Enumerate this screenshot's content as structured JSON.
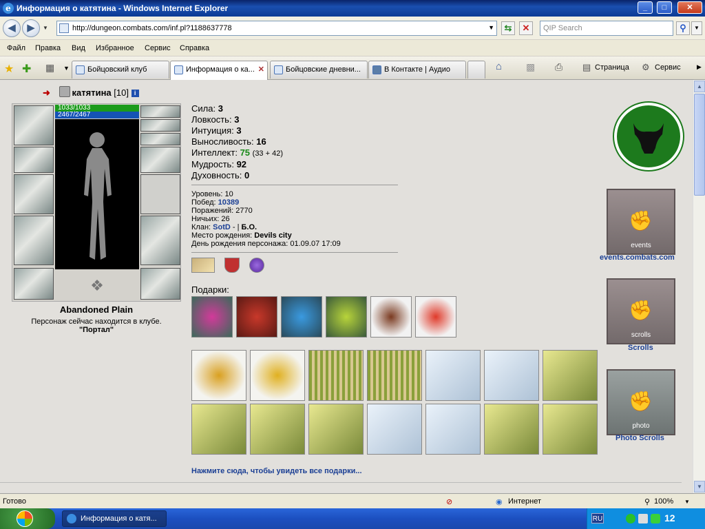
{
  "window": {
    "title": "Информация о катятина - Windows Internet Explorer",
    "minimize": "_",
    "maximize": "□",
    "close": "✕"
  },
  "address": {
    "url": "http://dungeon.combats.com/inf.pl?1188637778",
    "search_placeholder": "QIP Search"
  },
  "menu": [
    "Файл",
    "Правка",
    "Вид",
    "Избранное",
    "Сервис",
    "Справка"
  ],
  "tabs": [
    {
      "label": "Бойцовский клуб",
      "active": false
    },
    {
      "label": "Информация о ка...",
      "active": true
    },
    {
      "label": "Бойцовские дневни...",
      "active": false
    },
    {
      "label": "В Контакте | Аудио",
      "active": false
    }
  ],
  "commands": {
    "page": "Страница",
    "tools": "Сервис"
  },
  "character": {
    "name": "катятина",
    "level_tag": "[10]",
    "info_icon": "i",
    "hp": "1033/1033",
    "mp": "2467/2467",
    "location": "Abandoned Plain",
    "where_text": "Персонаж сейчас находится в клубе.",
    "room": "\"Портал\""
  },
  "stats": {
    "strength_label": "Сила:",
    "strength": "3",
    "agility_label": "Ловкость:",
    "agility": "3",
    "intuition_label": "Интуиция:",
    "intuition": "3",
    "endurance_label": "Выносливость:",
    "endurance": "16",
    "intellect_label": "Интеллект:",
    "intellect": "75",
    "intellect_extra": "(33 + 42)",
    "wisdom_label": "Мудрость:",
    "wisdom": "92",
    "spirit_label": "Духовность:",
    "spirit": "0"
  },
  "info": {
    "level_label": "Уровень:",
    "level": "10",
    "wins_label": "Побед:",
    "wins": "10389",
    "losses_label": "Поражений:",
    "losses": "2770",
    "draws_label": "Ничьих:",
    "draws": "26",
    "clan_label": "Клан:",
    "clan": "SotD",
    "clan_rest": " - | ",
    "clan_rank": "Б.О.",
    "birthplace_label": "Место рождения:",
    "birthplace": "Devils city",
    "birthday_label": "День рождения персонажа:",
    "birthday": "01.09.07 17:09"
  },
  "gifts": {
    "label": "Подарки:",
    "more_link": "Нажмите сюда, чтобы увидеть все подарки..."
  },
  "right": {
    "events_link": "events.combats.com",
    "events_banner": "events",
    "scrolls_link": "Scrolls",
    "scrolls_banner": "scrolls",
    "photo_link": "Photo Scrolls",
    "photo_banner": "photo"
  },
  "status": {
    "ready": "Готово",
    "zone": "Интернет",
    "zoom": "100%"
  },
  "taskbar": {
    "task": "Информация о катя...",
    "lang": "RU",
    "clock": "12"
  },
  "colors": {
    "accent_blue": "#1b3f94",
    "stat_green": "#198a19",
    "hp_green": "#1b9b1b",
    "mp_blue": "#1553b5",
    "logo_green": "#1d7a1d"
  }
}
